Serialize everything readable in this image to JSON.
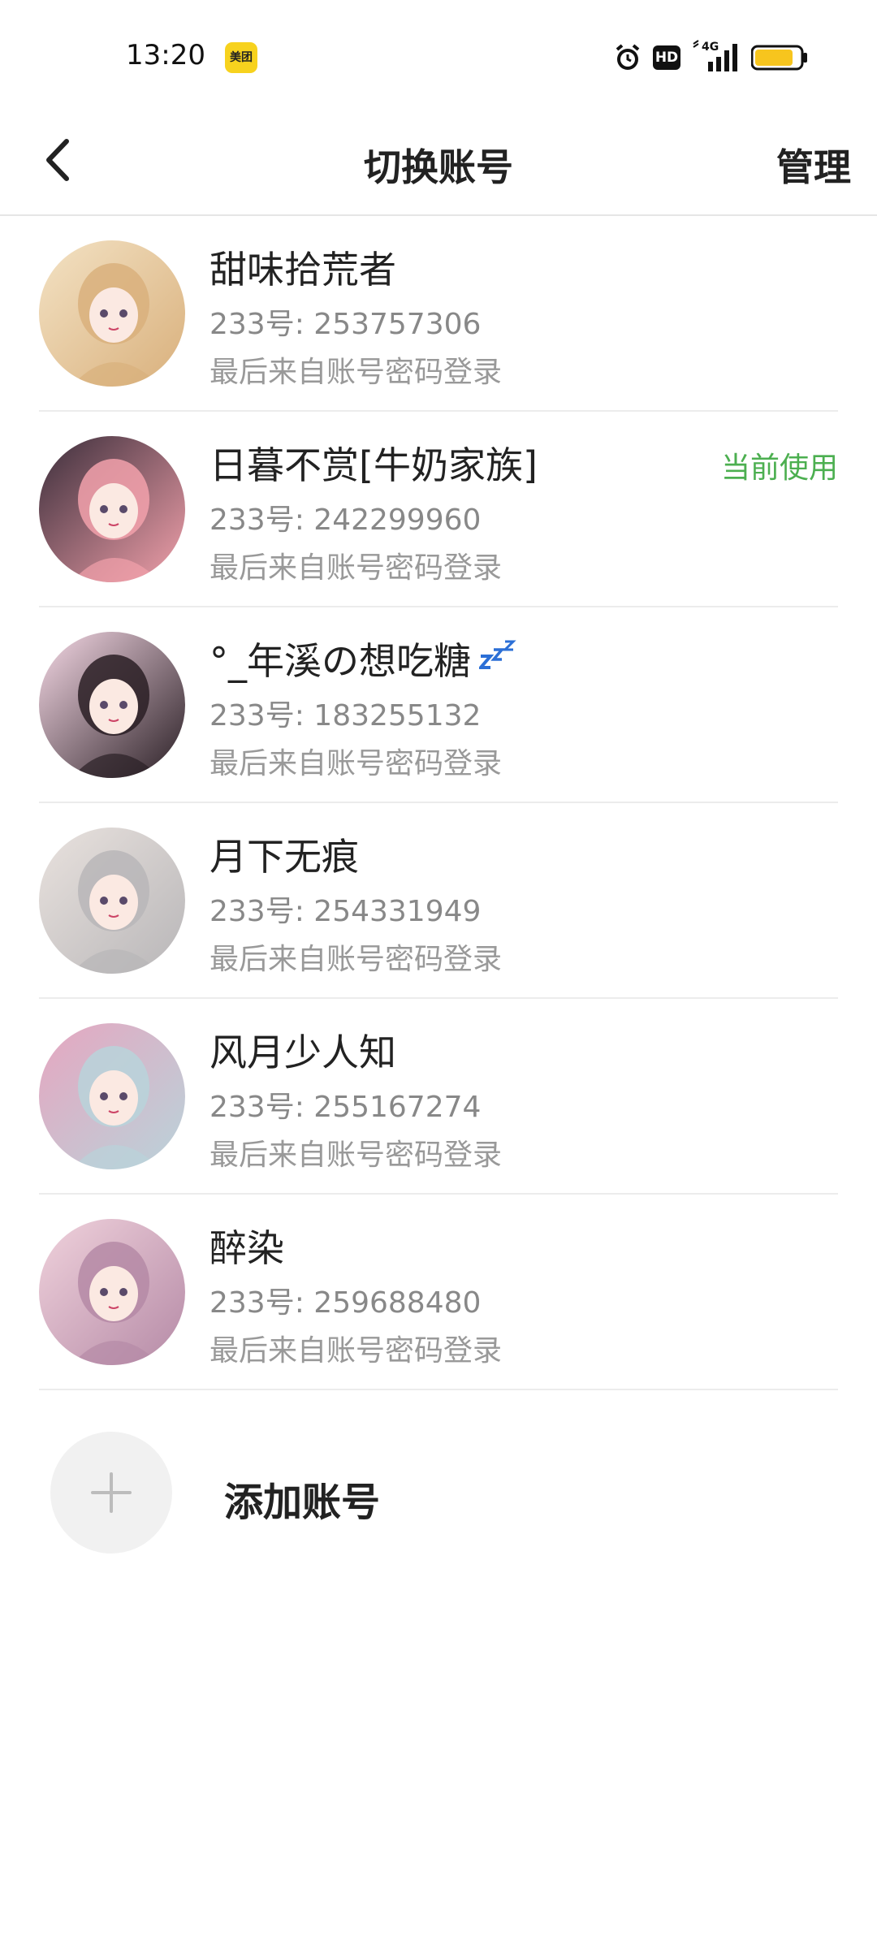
{
  "status_bar": {
    "time": "13:20",
    "app_badge": "美团",
    "hd_label": "HD",
    "network_label": "4G",
    "battery_level": 0.85,
    "battery_color": "#f7c51e"
  },
  "header": {
    "title": "切换账号",
    "manage_label": "管理"
  },
  "accounts": [
    {
      "name": "甜味拾荒者",
      "id_text": "233号: 253757306",
      "login_text": "最后来自账号密码登录",
      "current": false,
      "avatar_icon": "anime-girl-hat-avatar",
      "avatar_colors": [
        "#d9b07c",
        "#f3e2c4"
      ]
    },
    {
      "name": "日暮不赏[牛奶家族]",
      "id_text": "233号: 242299960",
      "login_text": "最后来自账号密码登录",
      "current": true,
      "current_label": "当前使用",
      "avatar_icon": "anime-girl-pink-hair-avatar",
      "avatar_colors": [
        "#f2a1ab",
        "#3a2d3a"
      ]
    },
    {
      "name": "°_年溪の想吃糖",
      "id_text": "233号: 183255132",
      "login_text": "最后来自账号密码登录",
      "current": false,
      "avatar_icon": "anime-girl-dark-hair-avatar",
      "avatar_colors": [
        "#2a1f25",
        "#f6d9e6"
      ]
    },
    {
      "name": "月下无痕",
      "id_text": "233号: 254331949",
      "login_text": "最后来自账号密码登录",
      "current": false,
      "avatar_icon": "painted-girl-gray-hair-avatar",
      "avatar_colors": [
        "#b8b6b8",
        "#e9e2de"
      ]
    },
    {
      "name": "风月少人知",
      "id_text": "233号: 255167274",
      "login_text": "最后来自账号密码登录",
      "current": false,
      "avatar_icon": "girl-bubblegum-avatar",
      "avatar_colors": [
        "#b9d3da",
        "#e6a6c0"
      ]
    },
    {
      "name": "醉染",
      "id_text": "233号: 259688480",
      "login_text": "最后来自账号密码登录",
      "current": false,
      "avatar_icon": "anime-girl-purple-avatar",
      "avatar_colors": [
        "#b58aa6",
        "#f0d2dc"
      ]
    }
  ],
  "add_account": {
    "label": "添加账号",
    "icon": "plus-icon"
  },
  "colors": {
    "current_badge": "#4caf50",
    "divider": "#ececec"
  }
}
